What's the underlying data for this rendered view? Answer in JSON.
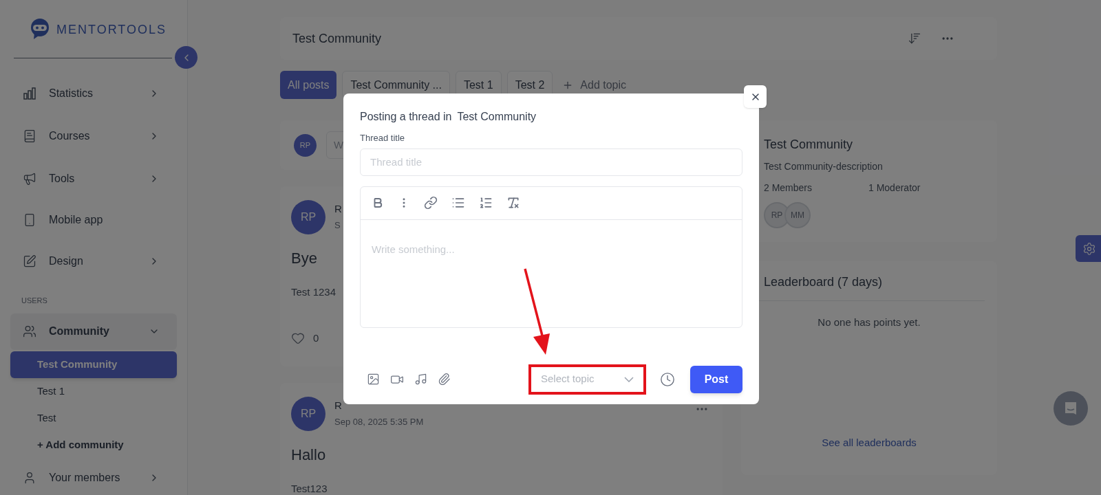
{
  "sidebar": {
    "logo": "MENTORTOOLS",
    "items": [
      {
        "label": "Statistics",
        "kind": "group"
      },
      {
        "label": "Courses",
        "kind": "group"
      },
      {
        "label": "Tools",
        "kind": "group"
      },
      {
        "label": "Mobile app",
        "kind": "link"
      },
      {
        "label": "Design",
        "kind": "group"
      }
    ],
    "section_label": "USERS",
    "community": {
      "label": "Community",
      "expanded": true,
      "children": [
        {
          "label": "Test Community",
          "selected": true
        },
        {
          "label": "Test 1",
          "selected": false
        },
        {
          "label": "Test",
          "selected": false
        }
      ],
      "add_label": "+ Add community"
    },
    "after_items": [
      {
        "label": "Your members",
        "kind": "group"
      }
    ]
  },
  "main": {
    "header": {
      "title": "Test Community"
    },
    "tabs": [
      {
        "label": "All posts",
        "selected": true
      },
      {
        "label": "Test Community ...",
        "selected": false
      },
      {
        "label": "Test 1",
        "selected": false
      },
      {
        "label": "Test 2",
        "selected": false
      }
    ],
    "add_topic": "Add topic",
    "composer": {
      "avatar": "RP",
      "placeholder": "W"
    },
    "posts": [
      {
        "avatar": "RP",
        "author": "R",
        "date": "S",
        "title": "Bye",
        "body": "Test 1234",
        "likes": "0"
      },
      {
        "avatar": "RP",
        "author": "R",
        "date": "Sep 08, 2025 5:35 PM",
        "title": "Hallo",
        "body": "Test123",
        "more_menu": true
      }
    ]
  },
  "right": {
    "community": {
      "title": "Test Community",
      "description": "Test Community-description",
      "members": "2 Members",
      "moderators": "1 Moderator",
      "avatars": [
        "RP",
        "MM"
      ]
    },
    "leaderboard": {
      "title": "Leaderboard (7 days)",
      "empty": "No one has points yet.",
      "link": "See all leaderboards"
    }
  },
  "modal": {
    "heading_prefix": "Posting a thread in",
    "community": "Test Community",
    "title_label": "Thread title",
    "title_placeholder": "Thread title",
    "body_placeholder": "Write something...",
    "topic_placeholder": "Select topic",
    "topic_highlighted": true,
    "post_button": "Post"
  }
}
